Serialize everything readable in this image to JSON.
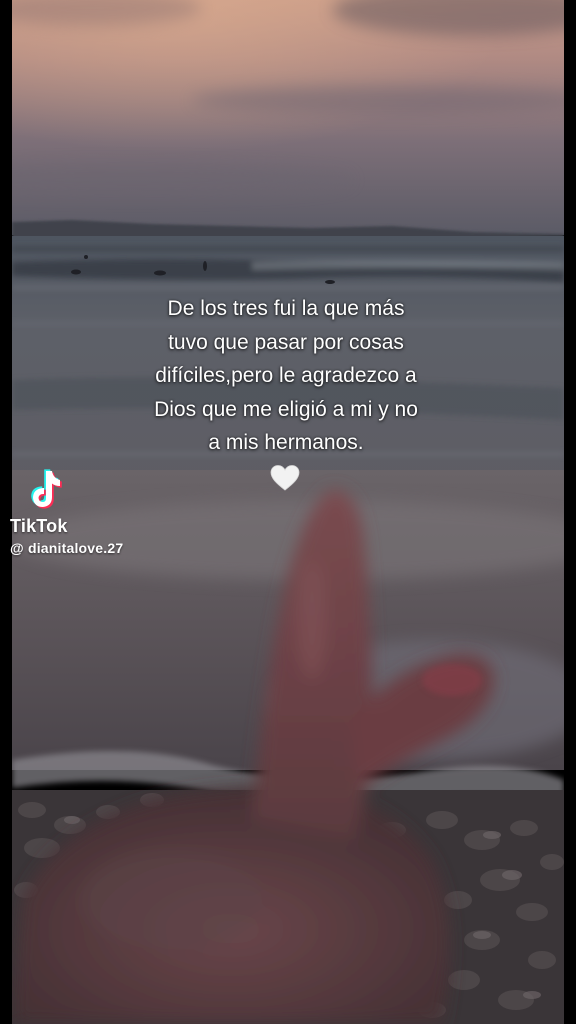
{
  "caption": {
    "lines": [
      "De los tres fui la que más",
      "tuvo que pasar por cosas",
      "difíciles,pero le agradezco a",
      "Dios que me eligió a mi y no",
      "a mis hermanos."
    ]
  },
  "emoji": {
    "icon": "white-heart-icon",
    "color": "#f2f2f2"
  },
  "watermark": {
    "logo_icon": "tiktok-logo-icon",
    "brand": "TikTok",
    "handle": "@ dianitalove.27",
    "colors": {
      "cyan": "#25f4ee",
      "red": "#fe2c55",
      "white": "#ffffff"
    }
  }
}
